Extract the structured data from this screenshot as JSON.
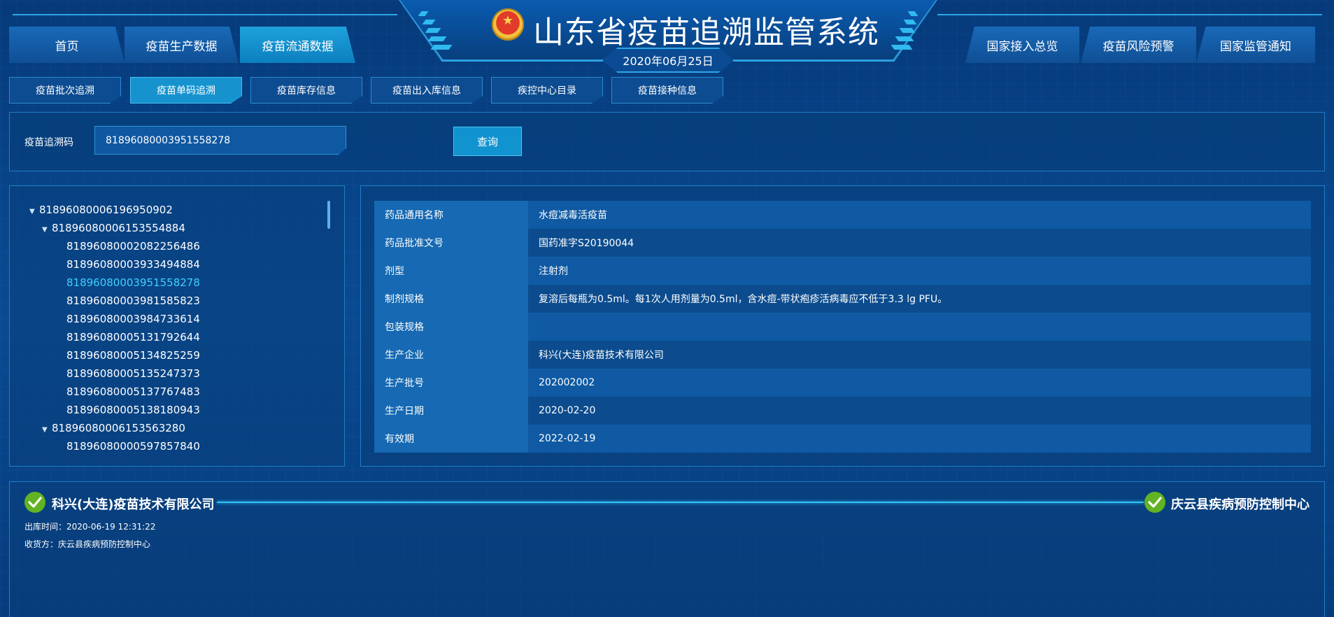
{
  "header": {
    "title": "山东省疫苗追溯监管系统",
    "date": "2020年06月25日"
  },
  "nav_left": [
    {
      "label": "首页"
    },
    {
      "label": "疫苗生产数据"
    },
    {
      "label": "疫苗流通数据",
      "active": true
    }
  ],
  "nav_right": [
    {
      "label": "国家接入总览"
    },
    {
      "label": "疫苗风险预警"
    },
    {
      "label": "国家监管通知"
    }
  ],
  "sub_tabs": [
    {
      "label": "疫苗批次追溯"
    },
    {
      "label": "疫苗单码追溯",
      "active": true
    },
    {
      "label": "疫苗库存信息"
    },
    {
      "label": "疫苗出入库信息"
    },
    {
      "label": "疾控中心目录"
    },
    {
      "label": "疫苗接种信息"
    }
  ],
  "search": {
    "label": "疫苗追溯码",
    "value": "81896080003951558278",
    "button": "查询"
  },
  "tree": {
    "root": "81896080006196950902",
    "group1": "81896080006153554884",
    "group1_items": [
      "81896080002082256486",
      "81896080003933494884",
      "81896080003951558278",
      "81896080003981585823",
      "81896080003984733614",
      "81896080005131792644",
      "81896080005134825259",
      "81896080005135247373",
      "81896080005137767483",
      "81896080005138180943"
    ],
    "group2": "81896080006153563280",
    "group2_items": [
      "81896080000597857840"
    ],
    "selected": "81896080003951558278"
  },
  "details": [
    {
      "key": "药品通用名称",
      "value": "水痘减毒活疫苗"
    },
    {
      "key": "药品批准文号",
      "value": "国药准字S20190044"
    },
    {
      "key": "剂型",
      "value": "注射剂"
    },
    {
      "key": "制剂规格",
      "value": "复溶后每瓶为0.5ml。每1次人用剂量为0.5ml，含水痘-带状疱疹活病毒应不低于3.3 lg PFU。"
    },
    {
      "key": "包装规格",
      "value": ""
    },
    {
      "key": "生产企业",
      "value": "科兴(大连)疫苗技术有限公司"
    },
    {
      "key": "生产批号",
      "value": "202002002"
    },
    {
      "key": "生产日期",
      "value": "2020-02-20"
    },
    {
      "key": "有效期",
      "value": "2022-02-19"
    }
  ],
  "flow": {
    "from": "科兴(大连)疫苗技术有限公司",
    "to": "庆云县疾病预防控制中心",
    "out_time": "出库时间：2020-06-19 12:31:22",
    "receiver": "收货方：庆云县疾病预防控制中心"
  },
  "colors": {
    "background": "#073a78",
    "accent": "#31c3f4",
    "active_tab": "#1693cf",
    "check": "#62b324",
    "selected_text": "#3fd0ff"
  },
  "icons": [
    "national-emblem-icon",
    "check-circle-icon",
    "caret-down-icon",
    "scrollbar"
  ]
}
